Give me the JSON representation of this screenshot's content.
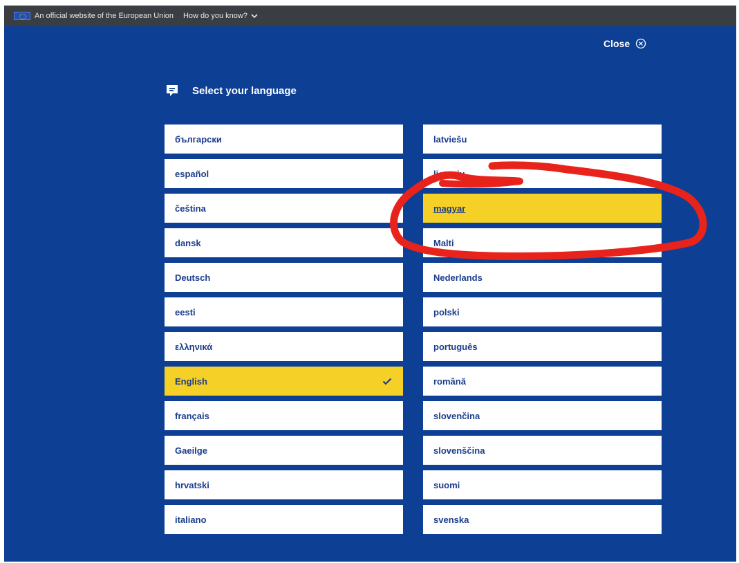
{
  "topbar": {
    "official_text": "An official website of the European Union",
    "how_text": "How do you know?"
  },
  "close": {
    "label": "Close"
  },
  "title": {
    "text": "Select your language"
  },
  "languages_left": [
    {
      "label": "български"
    },
    {
      "label": "español"
    },
    {
      "label": "čeština"
    },
    {
      "label": "dansk"
    },
    {
      "label": "Deutsch"
    },
    {
      "label": "eesti"
    },
    {
      "label": "ελληνικά"
    },
    {
      "label": "English",
      "selected": true
    },
    {
      "label": "français"
    },
    {
      "label": "Gaeilge"
    },
    {
      "label": "hrvatski"
    },
    {
      "label": "italiano"
    }
  ],
  "languages_right": [
    {
      "label": "latviešu"
    },
    {
      "label": "lietuvių"
    },
    {
      "label": "magyar",
      "highlighted": true
    },
    {
      "label": "Malti"
    },
    {
      "label": "Nederlands"
    },
    {
      "label": "polski"
    },
    {
      "label": "português"
    },
    {
      "label": "română"
    },
    {
      "label": "slovenčina"
    },
    {
      "label": "slovenščina"
    },
    {
      "label": "suomi"
    },
    {
      "label": "svenska"
    }
  ],
  "colors": {
    "background": "#0d3f95",
    "selected": "#f5d027",
    "annotation": "#e8231b"
  }
}
